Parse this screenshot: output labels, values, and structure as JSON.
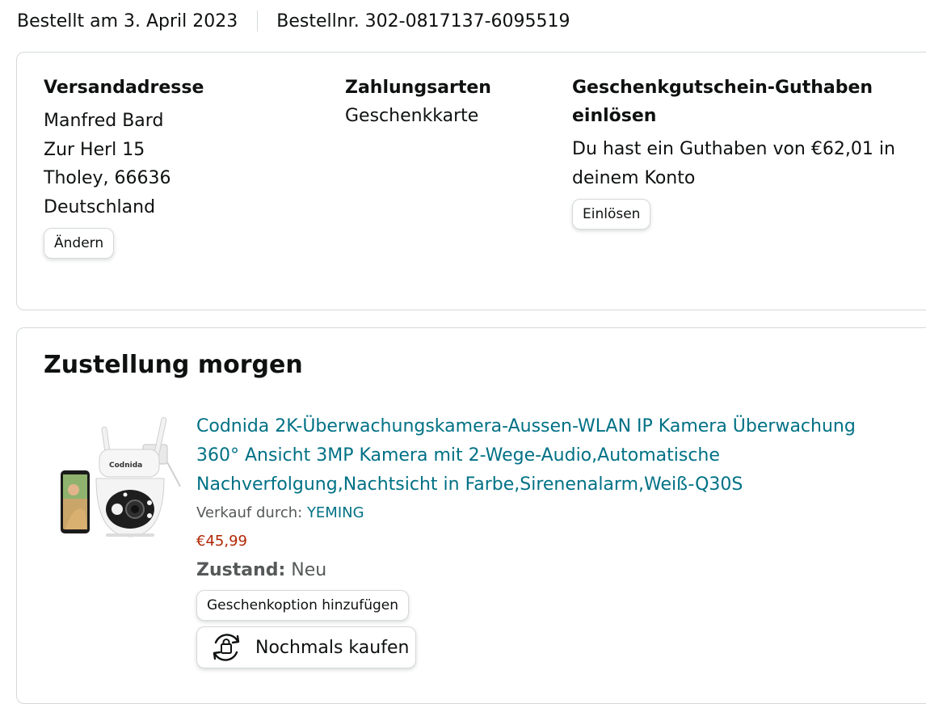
{
  "order": {
    "ordered_on": "Bestellt am 3. April 2023",
    "order_number": "Bestellnr. 302-0817137-6095519"
  },
  "shipping": {
    "title": "Versandadresse",
    "name": "Manfred Bard",
    "street": "Zur Herl 15",
    "city": "Tholey, 66636",
    "country": "Deutschland",
    "change_label": "Ändern"
  },
  "payment": {
    "title": "Zahlungsarten",
    "method": "Geschenkkarte"
  },
  "giftcard": {
    "title_line1": "Geschenkgutschein-Guthaben",
    "title_line2": "einlösen",
    "text_line1": "Du hast ein Guthaben von €62,01 in",
    "text_line2": "deinem Konto",
    "redeem_label": "Einlösen"
  },
  "delivery": {
    "title": "Zustellung morgen",
    "product": {
      "title_line1": "Codnida 2K-Überwachungskamera-Aussen-WLAN IP Kamera Überwachung",
      "title_line2": "360° Ansicht 3MP Kamera mit 2-Wege-Audio,Automatische",
      "title_line3": "Nachverfolgung,Nachtsicht in Farbe,Sirenenalarm,Weiß-Q30S",
      "seller_prefix": "Verkauf durch:",
      "seller_name": "YEMING",
      "price": "€45,99",
      "condition_label": "Zustand:",
      "condition_value": "Neu",
      "brand_on_image": "Codnida"
    },
    "gift_option_label": "Geschenkoption hinzufügen",
    "buy_again_label": "Nochmals kaufen"
  },
  "colors": {
    "link": "#007185",
    "price": "#b12704",
    "border": "#d5d9d9",
    "text": "#0f1111",
    "muted": "#565959"
  },
  "icons": {
    "buy_again": "buy-again-icon"
  }
}
